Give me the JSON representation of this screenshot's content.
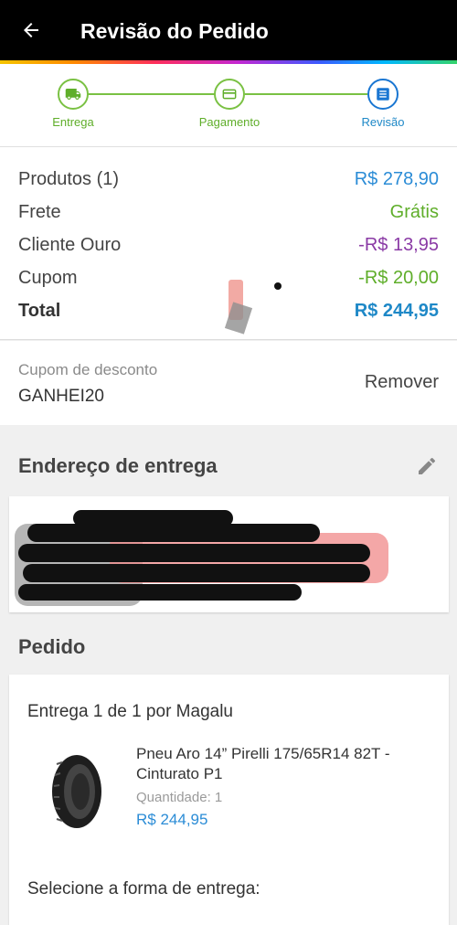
{
  "header": {
    "title": "Revisão do Pedido"
  },
  "stepper": {
    "steps": [
      {
        "label": "Entrega"
      },
      {
        "label": "Pagamento"
      },
      {
        "label": "Revisão"
      }
    ]
  },
  "summary": {
    "rows": [
      {
        "label": "Produtos (1)",
        "value": "R$ 278,90"
      },
      {
        "label": "Frete",
        "value": "Grátis"
      },
      {
        "label": "Cliente Ouro",
        "value": "-R$ 13,95"
      },
      {
        "label": "Cupom",
        "value": "-R$ 20,00"
      },
      {
        "label": "Total",
        "value": "R$ 244,95"
      }
    ]
  },
  "coupon": {
    "label": "Cupom de desconto",
    "code": "GANHEI20",
    "remove_label": "Remover"
  },
  "address": {
    "title": "Endereço de entrega"
  },
  "order": {
    "title": "Pedido",
    "delivery_title": "Entrega 1 de 1 por Magalu",
    "product_name": "Pneu Aro 14” Pirelli 175/65R14 82T - Cinturato P1",
    "quantity_label": "Quantidade:",
    "quantity": "1",
    "price": "R$ 244,95",
    "select_delivery": "Selecione a forma de entrega:"
  },
  "colors": {
    "accent_green": "#7ac143",
    "accent_blue": "#1e88c7",
    "discount_purple": "#8a3aa5",
    "appbar": "#000000"
  },
  "icons": [
    "back-arrow-icon",
    "truck-icon",
    "card-icon",
    "list-icon",
    "pencil-icon",
    "tire-image"
  ]
}
